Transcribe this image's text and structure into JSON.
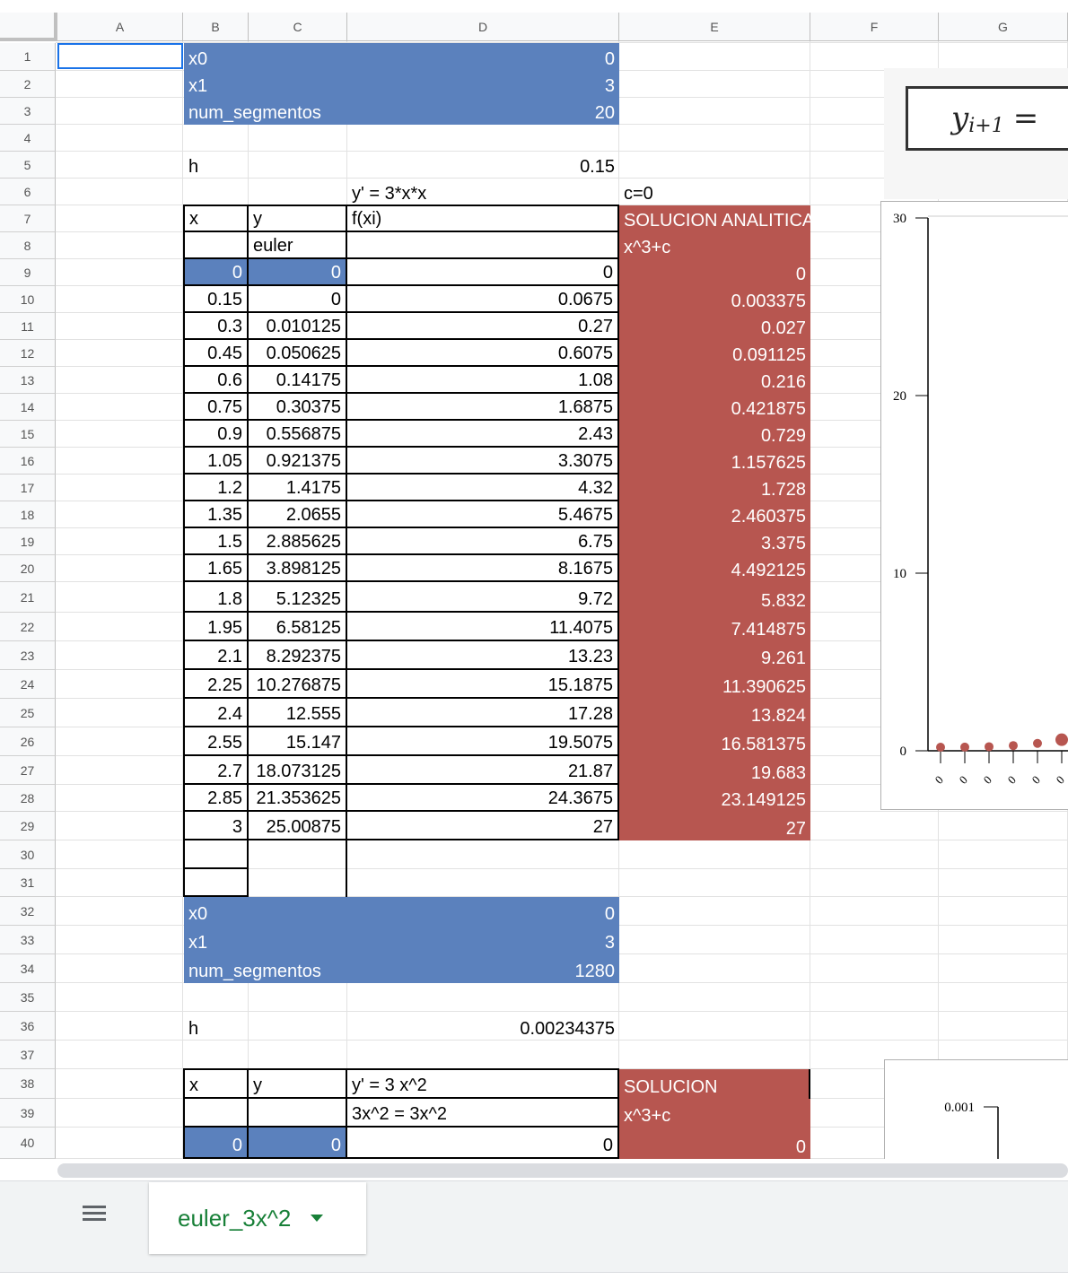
{
  "columns": [
    "A",
    "B",
    "C",
    "D",
    "E",
    "F",
    "G"
  ],
  "rows": [
    "1",
    "2",
    "3",
    "4",
    "5",
    "6",
    "7",
    "8",
    "9",
    "10",
    "11",
    "12",
    "13",
    "14",
    "15",
    "16",
    "17",
    "18",
    "19",
    "20",
    "21",
    "22",
    "23",
    "24",
    "25",
    "26",
    "27",
    "28",
    "29",
    "30",
    "31",
    "32",
    "33",
    "34",
    "35",
    "36",
    "37",
    "38",
    "39",
    "40"
  ],
  "params1": {
    "x0_label": "x0",
    "x0_value": "0",
    "x1_label": "x1",
    "x1_value": "3",
    "seg_label": "num_segmentos",
    "seg_value": "20",
    "h_label": "h",
    "h_value": "0.15"
  },
  "headers1": {
    "eq": "y' = 3*x*x",
    "c": "c=0",
    "x": "x",
    "y": "y",
    "fxi": "f(xi)",
    "sol": "SOLUCION ANALITICA",
    "euler": "euler",
    "formula": "x^3+c"
  },
  "table1": [
    {
      "x": "0",
      "y": "0",
      "f": "0",
      "s": "0"
    },
    {
      "x": "0.15",
      "y": "0",
      "f": "0.0675",
      "s": "0.003375"
    },
    {
      "x": "0.3",
      "y": "0.010125",
      "f": "0.27",
      "s": "0.027"
    },
    {
      "x": "0.45",
      "y": "0.050625",
      "f": "0.6075",
      "s": "0.091125"
    },
    {
      "x": "0.6",
      "y": "0.14175",
      "f": "1.08",
      "s": "0.216"
    },
    {
      "x": "0.75",
      "y": "0.30375",
      "f": "1.6875",
      "s": "0.421875"
    },
    {
      "x": "0.9",
      "y": "0.556875",
      "f": "2.43",
      "s": "0.729"
    },
    {
      "x": "1.05",
      "y": "0.921375",
      "f": "3.3075",
      "s": "1.157625"
    },
    {
      "x": "1.2",
      "y": "1.4175",
      "f": "4.32",
      "s": "1.728"
    },
    {
      "x": "1.35",
      "y": "2.0655",
      "f": "5.4675",
      "s": "2.460375"
    },
    {
      "x": "1.5",
      "y": "2.885625",
      "f": "6.75",
      "s": "3.375"
    },
    {
      "x": "1.65",
      "y": "3.898125",
      "f": "8.1675",
      "s": "4.492125"
    },
    {
      "x": "1.8",
      "y": "5.12325",
      "f": "9.72",
      "s": "5.832"
    },
    {
      "x": "1.95",
      "y": "6.58125",
      "f": "11.4075",
      "s": "7.414875"
    },
    {
      "x": "2.1",
      "y": "8.292375",
      "f": "13.23",
      "s": "9.261"
    },
    {
      "x": "2.25",
      "y": "10.276875",
      "f": "15.1875",
      "s": "11.390625"
    },
    {
      "x": "2.4",
      "y": "12.555",
      "f": "17.28",
      "s": "13.824"
    },
    {
      "x": "2.55",
      "y": "15.147",
      "f": "19.5075",
      "s": "16.581375"
    },
    {
      "x": "2.7",
      "y": "18.073125",
      "f": "21.87",
      "s": "19.683"
    },
    {
      "x": "2.85",
      "y": "21.353625",
      "f": "24.3675",
      "s": "23.149125"
    },
    {
      "x": "3",
      "y": "25.00875",
      "f": "27",
      "s": "27"
    }
  ],
  "params2": {
    "x0_label": "x0",
    "x0_value": "0",
    "x1_label": "x1",
    "x1_value": "3",
    "seg_label": "num_segmentos",
    "seg_value": "1280",
    "h_label": "h",
    "h_value": "0.00234375"
  },
  "headers2": {
    "x": "x",
    "y": "y",
    "eq": "y' = 3 x^2",
    "eq2": "3x^2 = 3x^2",
    "sol": "SOLUCION",
    "formula": "x^3+c"
  },
  "row40": {
    "x": "0",
    "y": "0",
    "f": "0",
    "s": "0"
  },
  "formula_image_text": "y",
  "formula_image_sub": "i+1",
  "formula_image_eq": "=",
  "chart1": {
    "y_ticks": [
      "30",
      "20",
      "10",
      "0"
    ],
    "ylim": [
      0,
      30
    ],
    "x_tick_labels": [
      "0",
      "0",
      "0",
      "0",
      "0",
      "0"
    ],
    "points": [
      0.0,
      0.003375,
      0.027,
      0.091125,
      0.216,
      0.421875
    ],
    "point_color": "#b75650"
  },
  "chart2": {
    "y_tick": "0.001"
  },
  "sheet_tab": {
    "name": "euler_3x^2"
  }
}
